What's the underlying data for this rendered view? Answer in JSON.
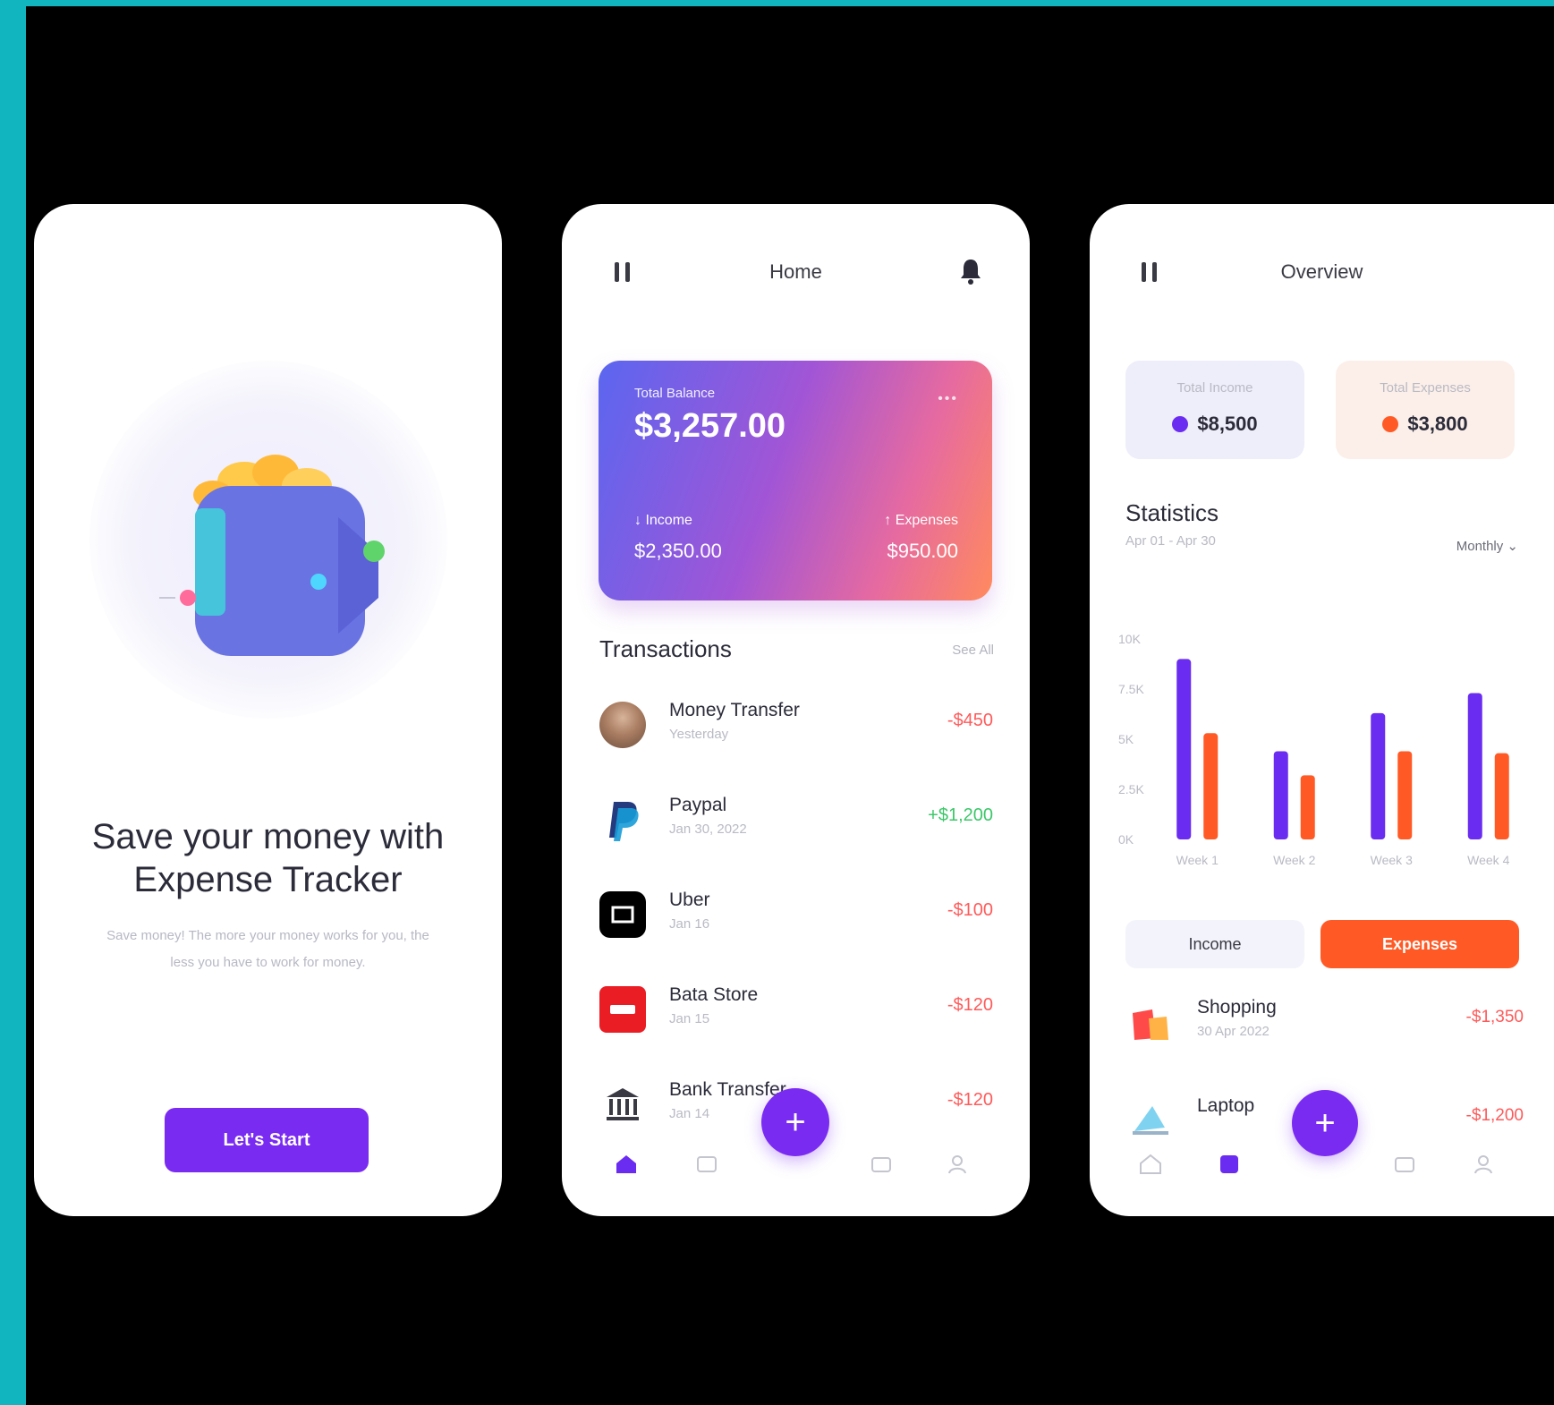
{
  "screen1": {
    "title": "Save your money with Expense Tracker",
    "description": "Save money! The more your money works for you, the less you have to work for money.",
    "cta_label": "Let's Start"
  },
  "screen2": {
    "header_title": "Home",
    "card": {
      "label": "Total Balance",
      "amount": "$3,257.00",
      "more": "•••",
      "income_label": "Income",
      "income_value": "$2,350.00",
      "expense_label": "Expenses",
      "expense_value": "$950.00"
    },
    "transactions_title": "Transactions",
    "see_all": "See All",
    "transactions": [
      {
        "name": "Money Transfer",
        "sub": "Yesterday",
        "amount": "-$450"
      },
      {
        "name": "Paypal",
        "sub": "Jan 30, 2022",
        "amount": "+$1,200"
      },
      {
        "name": "Uber",
        "sub": "Jan 16",
        "amount": "-$100"
      },
      {
        "name": "Bata Store",
        "sub": "Jan 15",
        "amount": "-$120"
      },
      {
        "name": "Bank Transfer",
        "sub": "Jan 14",
        "amount": "-$120"
      }
    ],
    "fab": "+"
  },
  "screen3": {
    "header_title": "Overview",
    "income_card": {
      "label": "Total Income",
      "value": "$8,500",
      "color": "#6a2cf0"
    },
    "expense_card": {
      "label": "Total Expenses",
      "value": "$3,800",
      "color": "#ff5a25"
    },
    "statistics_title": "Statistics",
    "date_range": "Apr 01 - Apr 30",
    "period": "Monthly ⌄",
    "toggle_income": "Income",
    "toggle_expense": "Expenses",
    "categories": [
      {
        "name": "Shopping",
        "sub": "30 Apr 2022",
        "amount": "-$1,350"
      },
      {
        "name": "Laptop",
        "sub": "",
        "amount": "-$1,200"
      }
    ],
    "fab": "+"
  },
  "colors": {
    "accent": "#7a2bf2",
    "expense": "#ff5a25",
    "negative": "#ff5a5a",
    "positive": "#3cc769",
    "teal_frame": "#11b5bf"
  },
  "chart_data": {
    "type": "bar",
    "categories": [
      "Week 1",
      "Week 2",
      "Week 3",
      "Week 4"
    ],
    "series": [
      {
        "values": [
          9.0,
          4.4,
          6.3,
          7.3
        ],
        "color": "#6a2cf0"
      },
      {
        "values": [
          5.3,
          3.2,
          4.4,
          4.3
        ],
        "color": "#ff5a25"
      }
    ],
    "ytick_labels": [
      "10K",
      "7.5K",
      "5K",
      "2.5K",
      "0K"
    ],
    "ylim": [
      0,
      12.5
    ],
    "grid": false
  }
}
